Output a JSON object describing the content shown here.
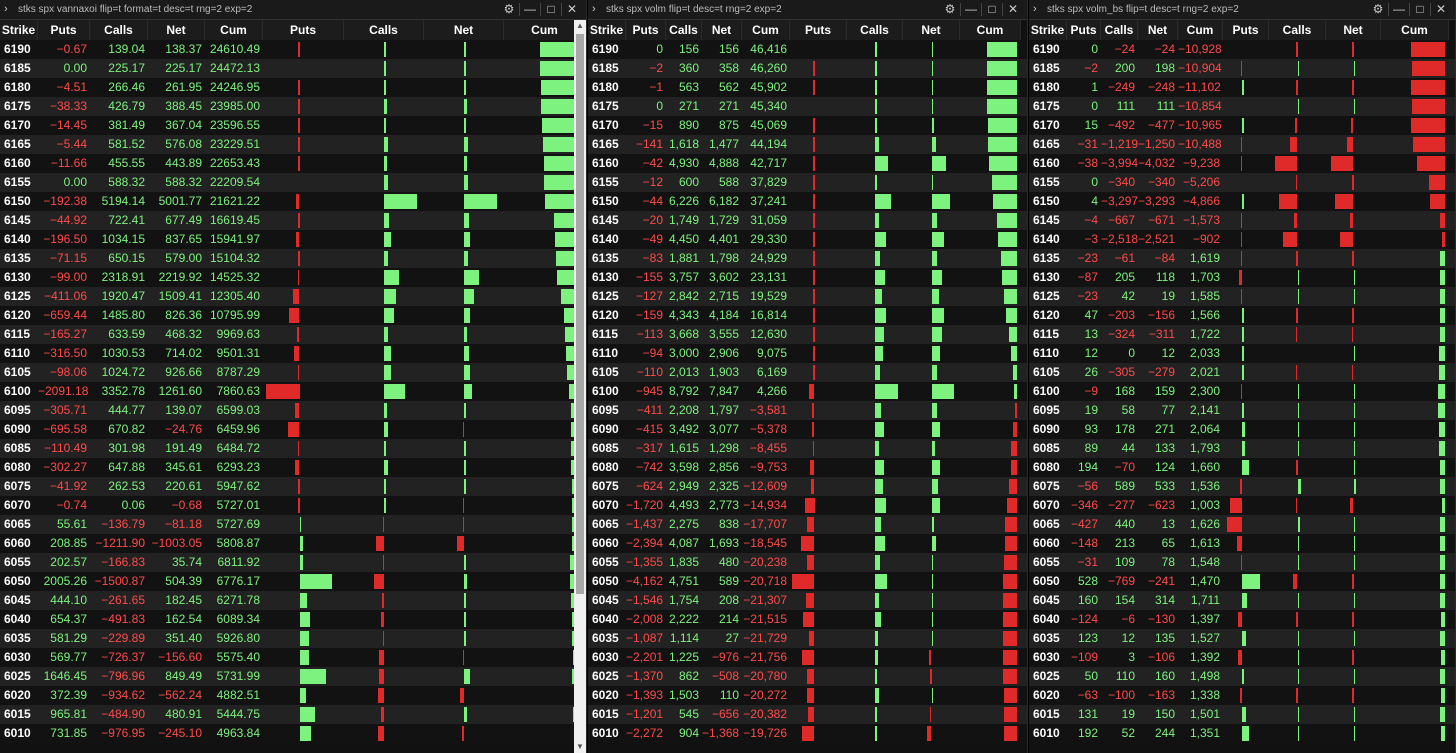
{
  "colors": {
    "positive": "#7ef27e",
    "negative": "#e02a2a",
    "bg": "#111111"
  },
  "icons": {
    "expand": "chevron-right-icon",
    "settings": "gear-icon",
    "minimize": "minimize-icon",
    "maximize": "maximize-icon",
    "close": "close-icon"
  },
  "panels": [
    {
      "title": "stks spx vannaxoi flip=t format=t desc=t rng=2 exp=2",
      "headers": [
        "Strike",
        "Puts",
        "Calls",
        "Net",
        "Cum",
        "Puts",
        "Calls",
        "Net",
        "Cum"
      ],
      "rows": [
        [
          "6190",
          "-0.67",
          "139.04",
          "138.37",
          "24610.49"
        ],
        [
          "6185",
          "0.00",
          "225.17",
          "225.17",
          "24472.13"
        ],
        [
          "6180",
          "-4.51",
          "266.46",
          "261.95",
          "24246.95"
        ],
        [
          "6175",
          "-38.33",
          "426.79",
          "388.45",
          "23985.00"
        ],
        [
          "6170",
          "-14.45",
          "381.49",
          "367.04",
          "23596.55"
        ],
        [
          "6165",
          "-5.44",
          "581.52",
          "576.08",
          "23229.51"
        ],
        [
          "6160",
          "-11.66",
          "455.55",
          "443.89",
          "22653.43"
        ],
        [
          "6155",
          "0.00",
          "588.32",
          "588.32",
          "22209.54"
        ],
        [
          "6150",
          "-192.38",
          "5194.14",
          "5001.77",
          "21621.22"
        ],
        [
          "6145",
          "-44.92",
          "722.41",
          "677.49",
          "16619.45"
        ],
        [
          "6140",
          "-196.50",
          "1034.15",
          "837.65",
          "15941.97"
        ],
        [
          "6135",
          "-71.15",
          "650.15",
          "579.00",
          "15104.32"
        ],
        [
          "6130",
          "-99.00",
          "2318.91",
          "2219.92",
          "14525.32"
        ],
        [
          "6125",
          "-411.06",
          "1920.47",
          "1509.41",
          "12305.40"
        ],
        [
          "6120",
          "-659.44",
          "1485.80",
          "826.36",
          "10795.99"
        ],
        [
          "6115",
          "-165.27",
          "633.59",
          "468.32",
          "9969.63"
        ],
        [
          "6110",
          "-316.50",
          "1030.53",
          "714.02",
          "9501.31"
        ],
        [
          "6105",
          "-98.06",
          "1024.72",
          "926.66",
          "8787.29"
        ],
        [
          "6100",
          "-2091.18",
          "3352.78",
          "1261.60",
          "7860.63"
        ],
        [
          "6095",
          "-305.71",
          "444.77",
          "139.07",
          "6599.03"
        ],
        [
          "6090",
          "-695.58",
          "670.82",
          "-24.76",
          "6459.96"
        ],
        [
          "6085",
          "-110.49",
          "301.98",
          "191.49",
          "6484.72"
        ],
        [
          "6080",
          "-302.27",
          "647.88",
          "345.61",
          "6293.23"
        ],
        [
          "6075",
          "-41.92",
          "262.53",
          "220.61",
          "5947.62"
        ],
        [
          "6070",
          "-0.74",
          "0.06",
          "-0.68",
          "5727.01"
        ],
        [
          "6065",
          "55.61",
          "-136.79",
          "-81.18",
          "5727.69"
        ],
        [
          "6060",
          "208.85",
          "-1211.90",
          "-1003.05",
          "5808.87"
        ],
        [
          "6055",
          "202.57",
          "-166.83",
          "35.74",
          "6811.92"
        ],
        [
          "6050",
          "2005.26",
          "-1500.87",
          "504.39",
          "6776.17"
        ],
        [
          "6045",
          "444.10",
          "-261.65",
          "182.45",
          "6271.78"
        ],
        [
          "6040",
          "654.37",
          "-491.83",
          "162.54",
          "6089.34"
        ],
        [
          "6035",
          "581.29",
          "-229.89",
          "351.40",
          "5926.80"
        ],
        [
          "6030",
          "569.77",
          "-726.37",
          "-156.60",
          "5575.40"
        ],
        [
          "6025",
          "1646.45",
          "-796.96",
          "849.49",
          "5731.99"
        ],
        [
          "6020",
          "372.39",
          "-934.62",
          "-562.24",
          "4882.51"
        ],
        [
          "6015",
          "965.81",
          "-484.90",
          "480.91",
          "5444.75"
        ],
        [
          "6010",
          "731.85",
          "-976.95",
          "-245.10",
          "4963.84"
        ]
      ]
    },
    {
      "title": "stks spx volm flip=t desc=t rng=2 exp=2",
      "headers": [
        "Strike",
        "Puts",
        "Calls",
        "Net",
        "Cum",
        "Puts",
        "Calls",
        "Net",
        "Cum"
      ],
      "rows": [
        [
          "6190",
          "0",
          "156",
          "156",
          "46,416"
        ],
        [
          "6185",
          "-2",
          "360",
          "358",
          "46,260"
        ],
        [
          "6180",
          "-1",
          "563",
          "562",
          "45,902"
        ],
        [
          "6175",
          "0",
          "271",
          "271",
          "45,340"
        ],
        [
          "6170",
          "-15",
          "890",
          "875",
          "45,069"
        ],
        [
          "6165",
          "-141",
          "1,618",
          "1,477",
          "44,194"
        ],
        [
          "6160",
          "-42",
          "4,930",
          "4,888",
          "42,717"
        ],
        [
          "6155",
          "-12",
          "600",
          "588",
          "37,829"
        ],
        [
          "6150",
          "-44",
          "6,226",
          "6,182",
          "37,241"
        ],
        [
          "6145",
          "-20",
          "1,749",
          "1,729",
          "31,059"
        ],
        [
          "6140",
          "-49",
          "4,450",
          "4,401",
          "29,330"
        ],
        [
          "6135",
          "-83",
          "1,881",
          "1,798",
          "24,929"
        ],
        [
          "6130",
          "-155",
          "3,757",
          "3,602",
          "23,131"
        ],
        [
          "6125",
          "-127",
          "2,842",
          "2,715",
          "19,529"
        ],
        [
          "6120",
          "-159",
          "4,343",
          "4,184",
          "16,814"
        ],
        [
          "6115",
          "-113",
          "3,668",
          "3,555",
          "12,630"
        ],
        [
          "6110",
          "-94",
          "3,000",
          "2,906",
          "9,075"
        ],
        [
          "6105",
          "-110",
          "2,013",
          "1,903",
          "6,169"
        ],
        [
          "6100",
          "-945",
          "8,792",
          "7,847",
          "4,266"
        ],
        [
          "6095",
          "-411",
          "2,208",
          "1,797",
          "-3,581"
        ],
        [
          "6090",
          "-415",
          "3,492",
          "3,077",
          "-5,378"
        ],
        [
          "6085",
          "-317",
          "1,615",
          "1,298",
          "-8,455"
        ],
        [
          "6080",
          "-742",
          "3,598",
          "2,856",
          "-9,753"
        ],
        [
          "6075",
          "-624",
          "2,949",
          "2,325",
          "-12,609"
        ],
        [
          "6070",
          "-1,720",
          "4,493",
          "2,773",
          "-14,934"
        ],
        [
          "6065",
          "-1,437",
          "2,275",
          "838",
          "-17,707"
        ],
        [
          "6060",
          "-2,394",
          "4,087",
          "1,693",
          "-18,545"
        ],
        [
          "6055",
          "-1,355",
          "1,835",
          "480",
          "-20,238"
        ],
        [
          "6050",
          "-4,162",
          "4,751",
          "589",
          "-20,718"
        ],
        [
          "6045",
          "-1,546",
          "1,754",
          "208",
          "-21,307"
        ],
        [
          "6040",
          "-2,008",
          "2,222",
          "214",
          "-21,515"
        ],
        [
          "6035",
          "-1,087",
          "1,114",
          "27",
          "-21,729"
        ],
        [
          "6030",
          "-2,201",
          "1,225",
          "-976",
          "-21,756"
        ],
        [
          "6025",
          "-1,370",
          "862",
          "-508",
          "-20,780"
        ],
        [
          "6020",
          "-1,393",
          "1,503",
          "110",
          "-20,272"
        ],
        [
          "6015",
          "-1,201",
          "545",
          "-656",
          "-20,382"
        ],
        [
          "6010",
          "-2,272",
          "904",
          "-1,368",
          "-19,726"
        ]
      ]
    },
    {
      "title": "stks spx volm_bs flip=t desc=t rng=2 exp=2",
      "headers": [
        "Strike",
        "Puts",
        "Calls",
        "Net",
        "Cum",
        "Puts",
        "Calls",
        "Net",
        "Cum"
      ],
      "rows": [
        [
          "6190",
          "0",
          "-24",
          "-24",
          "-10,928"
        ],
        [
          "6185",
          "-2",
          "200",
          "198",
          "-10,904"
        ],
        [
          "6180",
          "1",
          "-249",
          "-248",
          "-11,102"
        ],
        [
          "6175",
          "0",
          "111",
          "111",
          "-10,854"
        ],
        [
          "6170",
          "15",
          "-492",
          "-477",
          "-10,965"
        ],
        [
          "6165",
          "-31",
          "-1,219",
          "-1,250",
          "-10,488"
        ],
        [
          "6160",
          "-38",
          "-3,994",
          "-4,032",
          "-9,238"
        ],
        [
          "6155",
          "0",
          "-340",
          "-340",
          "-5,206"
        ],
        [
          "6150",
          "4",
          "-3,297",
          "-3,293",
          "-4,866"
        ],
        [
          "6145",
          "-4",
          "-667",
          "-671",
          "-1,573"
        ],
        [
          "6140",
          "-3",
          "-2,518",
          "-2,521",
          "-902"
        ],
        [
          "6135",
          "-23",
          "-61",
          "-84",
          "1,619"
        ],
        [
          "6130",
          "-87",
          "205",
          "118",
          "1,703"
        ],
        [
          "6125",
          "-23",
          "42",
          "19",
          "1,585"
        ],
        [
          "6120",
          "47",
          "-203",
          "-156",
          "1,566"
        ],
        [
          "6115",
          "13",
          "-324",
          "-311",
          "1,722"
        ],
        [
          "6110",
          "12",
          "0",
          "12",
          "2,033"
        ],
        [
          "6105",
          "26",
          "-305",
          "-279",
          "2,021"
        ],
        [
          "6100",
          "-9",
          "168",
          "159",
          "2,300"
        ],
        [
          "6095",
          "19",
          "58",
          "77",
          "2,141"
        ],
        [
          "6090",
          "93",
          "178",
          "271",
          "2,064"
        ],
        [
          "6085",
          "89",
          "44",
          "133",
          "1,793"
        ],
        [
          "6080",
          "194",
          "-70",
          "124",
          "1,660"
        ],
        [
          "6075",
          "-56",
          "589",
          "533",
          "1,536"
        ],
        [
          "6070",
          "-346",
          "-277",
          "-623",
          "1,003"
        ],
        [
          "6065",
          "-427",
          "440",
          "13",
          "1,626"
        ],
        [
          "6060",
          "-148",
          "213",
          "65",
          "1,613"
        ],
        [
          "6055",
          "-31",
          "109",
          "78",
          "1,548"
        ],
        [
          "6050",
          "528",
          "-769",
          "-241",
          "1,470"
        ],
        [
          "6045",
          "160",
          "154",
          "314",
          "1,711"
        ],
        [
          "6040",
          "-124",
          "-6",
          "-130",
          "1,397"
        ],
        [
          "6035",
          "123",
          "12",
          "135",
          "1,527"
        ],
        [
          "6030",
          "-109",
          "3",
          "-106",
          "1,392"
        ],
        [
          "6025",
          "50",
          "110",
          "160",
          "1,498"
        ],
        [
          "6020",
          "-63",
          "-100",
          "-163",
          "1,338"
        ],
        [
          "6015",
          "131",
          "19",
          "150",
          "1,501"
        ],
        [
          "6010",
          "192",
          "52",
          "244",
          "1,351"
        ]
      ]
    }
  ]
}
